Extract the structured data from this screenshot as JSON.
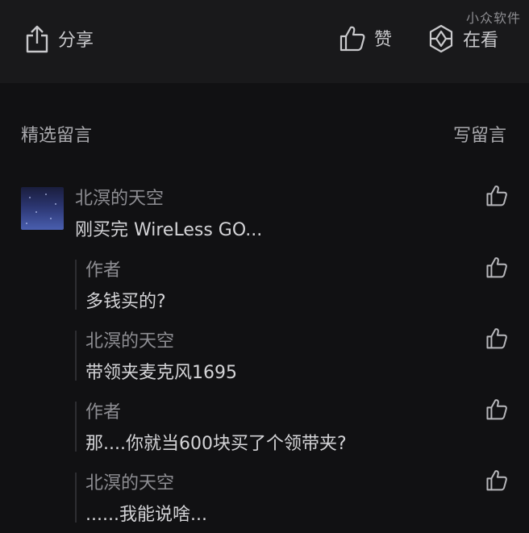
{
  "watermark": "小众软件",
  "toolbar": {
    "share_label": "分享",
    "like_label": "赞",
    "seeing_label": "在看"
  },
  "section": {
    "title": "精选留言",
    "write_label": "写留言"
  },
  "comments": [
    {
      "name": "北溟的天空",
      "text": "刚买完 WireLess GO...",
      "replies": [
        {
          "name": "作者",
          "text": "多钱买的?"
        },
        {
          "name": "北溟的天空",
          "text": "带领夹麦克风1695"
        },
        {
          "name": "作者",
          "text": "那....你就当600块买了个领带夹?"
        },
        {
          "name": "北溟的天空",
          "text": "......我能说啥..."
        }
      ]
    }
  ],
  "icons": {
    "share": "share-icon",
    "like": "thumbs-up-icon",
    "seeing": "seeing-icon"
  },
  "colors": {
    "background": "#111113",
    "toolbar_bg": "#19191b",
    "text_primary": "#d4d4d7",
    "text_secondary": "#8e8e93"
  }
}
